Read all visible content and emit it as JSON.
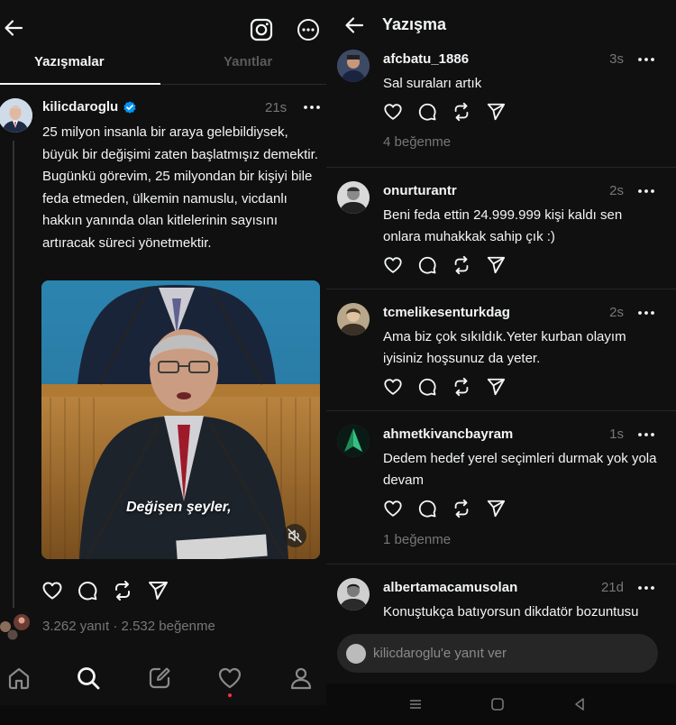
{
  "left": {
    "tabs": [
      "Yazışmalar",
      "Yanıtlar"
    ],
    "post": {
      "username": "kilicdaroglu",
      "time": "21s",
      "body": "25 milyon insanla bir araya gelebildiysek, büyük bir değişimi zaten başlatmışız demektir. Bugünkü görevim, 25 milyondan bir kişiyi bile feda etmeden, ülkemin namuslu, vicdanlı hakkın yanında olan kitlelerinin sayısını artıracak süreci yönetmektir.",
      "media_caption": "Değişen şeyler,",
      "stats": "3.262 yanıt · 2.532 beğenme"
    },
    "icons": [
      "back-arrow-icon",
      "instagram-icon",
      "more-icon",
      "verified-icon",
      "heart-icon",
      "comment-icon",
      "repost-icon",
      "share-icon",
      "home-icon",
      "search-icon",
      "compose-icon",
      "activity-icon",
      "profile-icon",
      "mute-icon"
    ]
  },
  "right": {
    "title": "Yazışma",
    "replies": [
      {
        "username": "afcbatu_1886",
        "time": "3s",
        "text": "Sal suraları artık",
        "likes": "4 beğenme"
      },
      {
        "username": "onurturantr",
        "time": "2s",
        "text": "Beni feda ettin 24.999.999 kişi kaldı sen onlara muhakkak sahip çık :)",
        "likes": ""
      },
      {
        "username": "tcmelikesenturkdag",
        "time": "2s",
        "text": "Ama biz çok sıkıldık.Yeter kurban olayım iyisiniz hoşsunuz da yeter.",
        "likes": ""
      },
      {
        "username": "ahmetkivancbayram",
        "time": "1s",
        "text": "Dedem hedef yerel seçimleri durmak yok yola devam",
        "likes": "1 beğenme"
      },
      {
        "username": "albertamacamusolan",
        "time": "21d",
        "text": "Konuştukça batıyorsun dikdatör bozuntusu",
        "likes": ""
      }
    ],
    "reply_placeholder": "kilicdaroglu'e yanıt ver"
  },
  "colors": {
    "background": "#101010",
    "text": "#f3f5f7",
    "muted": "#777777",
    "verified": "#0095f6",
    "notification": "#ff3040"
  }
}
